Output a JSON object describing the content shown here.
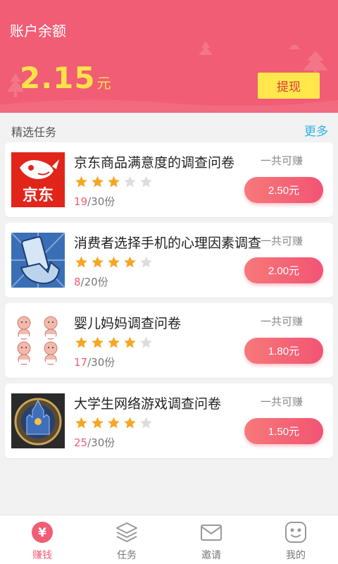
{
  "header": {
    "title": "账户余额",
    "amount": "2.15",
    "unit": "元",
    "withdraw_label": "提现"
  },
  "section": {
    "title": "精选任务",
    "more_label": "更多"
  },
  "tasks": [
    {
      "name": "京东商品满意度的调查问卷",
      "total_label": "一共可赚",
      "rating": 3,
      "max_rating": 5,
      "done": "19",
      "quota": "/30份",
      "reward": "2.50元",
      "thumb": "jd-logo"
    },
    {
      "name": "消费者选择手机的心理因素调查",
      "total_label": "一共可赚",
      "rating": 4,
      "max_rating": 5,
      "done": "8",
      "quota": "/20份",
      "reward": "2.00元",
      "thumb": "hand-phone-image"
    },
    {
      "name": "婴儿妈妈调查问卷",
      "total_label": "一共可赚",
      "rating": 4,
      "max_rating": 5,
      "done": "17",
      "quota": "/30份",
      "reward": "1.80元",
      "thumb": "babies-image"
    },
    {
      "name": "大学生网络游戏调查问卷",
      "total_label": "一共可赚",
      "rating": 4,
      "max_rating": 5,
      "done": "25",
      "quota": "/30份",
      "reward": "1.50元",
      "thumb": "game-castle-image"
    }
  ],
  "jd_logo_text": "京东",
  "tabbar": {
    "items": [
      {
        "label": "赚钱",
        "icon": "yen-icon",
        "active": true
      },
      {
        "label": "任务",
        "icon": "layers-icon",
        "active": false
      },
      {
        "label": "邀请",
        "icon": "envelope-icon",
        "active": false
      },
      {
        "label": "我的",
        "icon": "smiley-icon",
        "active": false
      }
    ],
    "yen_glyph": "¥"
  },
  "colors": {
    "brand": "#f05d74",
    "amount": "#ffe24a",
    "withdraw_bg": "#ffe74c",
    "star_on": "#f5a623",
    "star_off": "#dddddd",
    "more_link": "#2fb2e6"
  }
}
